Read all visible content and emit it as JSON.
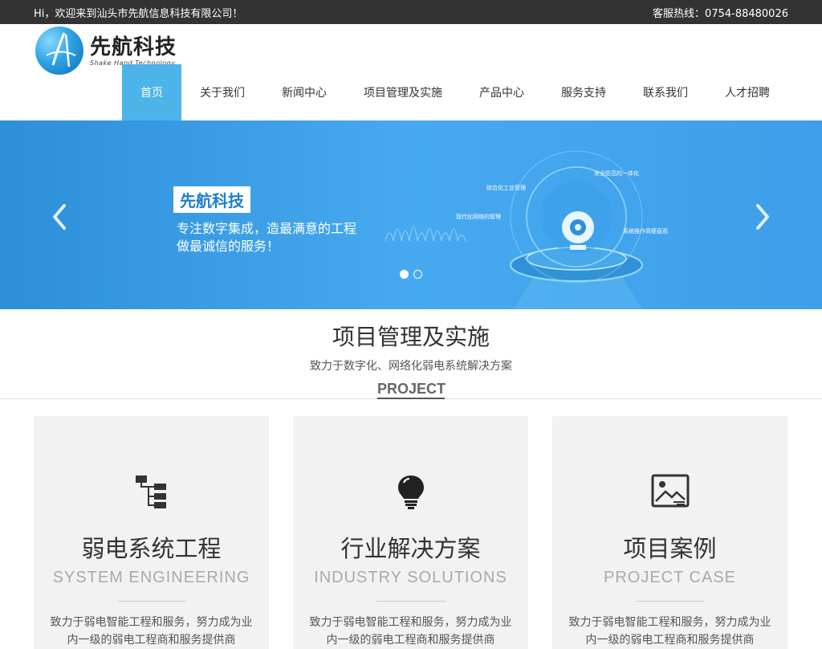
{
  "topbar": {
    "welcome": "Hi，欢迎来到汕头市先航信息科技有限公司！",
    "hotline": "客服热线：0754-88480026"
  },
  "logo": {
    "cn": "先航科技",
    "en": "Shake Hand Technology",
    "icon": "logo-icon"
  },
  "nav": {
    "items": [
      {
        "label": "首页",
        "active": true
      },
      {
        "label": "关于我们"
      },
      {
        "label": "新闻中心"
      },
      {
        "label": "项目管理及实施"
      },
      {
        "label": "产品中心"
      },
      {
        "label": "服务支持"
      },
      {
        "label": "联系我们"
      },
      {
        "label": "人才招聘"
      }
    ]
  },
  "banner": {
    "badge": "先航科技",
    "line1": "专注数字集成，造最满意的工程",
    "line2": "做最诚信的服务！",
    "labels": [
      "安全防范的一体化",
      "综合化工业管理",
      "现代化网络的管理",
      "系统操作简便直观"
    ],
    "prev_icon": "chevron-left-icon",
    "next_icon": "chevron-right-icon",
    "slides": 2,
    "current_slide": 1
  },
  "section": {
    "title": "项目管理及实施",
    "subtitle": "致力于数字化、网络化弱电系统解决方案",
    "en": "PROJECT"
  },
  "cards": [
    {
      "title": "弱电系统工程",
      "en": "SYSTEM ENGINEERING",
      "desc1": "致力于弱电智能工程和服务，努力成为业",
      "desc2": "内一级的弱电工程商和服务提供商",
      "icon": "sitemap-icon"
    },
    {
      "title": "行业解决方案",
      "en": "INDUSTRY SOLUTIONS",
      "desc1": "致力于弱电智能工程和服务，努力成为业",
      "desc2": "内一级的弱电工程商和服务提供商",
      "icon": "lightbulb-icon"
    },
    {
      "title": "项目案例",
      "en": "PROJECT CASE",
      "desc1": "致力于弱电智能工程和服务，努力成为业",
      "desc2": "内一级的弱电工程商和服务提供商",
      "icon": "image-icon"
    }
  ],
  "colors": {
    "topbar": "#333333",
    "accent": "#4db4e9",
    "banner": "#3d9fe9",
    "card_bg": "#f2f2f2"
  }
}
